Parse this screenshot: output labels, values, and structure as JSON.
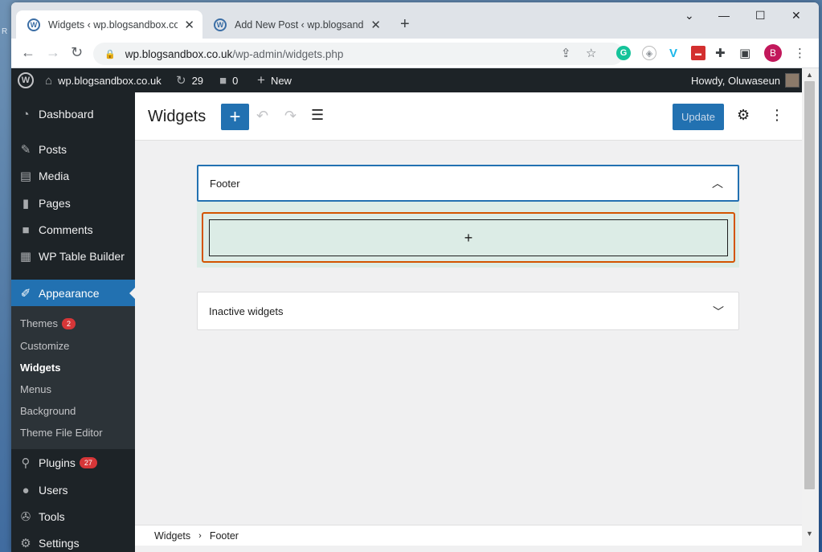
{
  "desktop": {
    "edge_text": "R"
  },
  "browser": {
    "tabs": [
      {
        "title": "Widgets ‹ wp.blogsandbox.co.uk",
        "favicon": "wordpress-icon"
      },
      {
        "title": "Add New Post ‹ wp.blogsandbox.co.uk",
        "favicon": "wordpress-icon"
      }
    ],
    "url_host": "wp.blogsandbox.co.uk",
    "url_path": "/wp-admin/widgets.php",
    "profile_initial": "B",
    "window_controls": [
      "minimize",
      "maximize",
      "close"
    ],
    "extensions": [
      "grammarly-icon",
      "shield-icon",
      "vimeo-icon",
      "red-extension-icon",
      "puzzle-icon",
      "sidepanel-icon"
    ]
  },
  "adminbar": {
    "site_name": "wp.blogsandbox.co.uk",
    "updates_count": "29",
    "comments_count": "0",
    "new_label": "New",
    "howdy": "Howdy, Oluwaseun"
  },
  "sidebar": {
    "items": [
      {
        "label": "Dashboard",
        "icon": "dashboard-icon"
      },
      {
        "label": "Posts",
        "icon": "pin-icon"
      },
      {
        "label": "Media",
        "icon": "media-icon"
      },
      {
        "label": "Pages",
        "icon": "pages-icon"
      },
      {
        "label": "Comments",
        "icon": "comments-icon"
      },
      {
        "label": "WP Table Builder",
        "icon": "table-icon"
      },
      {
        "label": "Appearance",
        "icon": "brush-icon"
      },
      {
        "label": "Plugins",
        "icon": "plugin-icon",
        "badge": "27"
      },
      {
        "label": "Users",
        "icon": "users-icon"
      },
      {
        "label": "Tools",
        "icon": "tools-icon"
      },
      {
        "label": "Settings",
        "icon": "settings-icon"
      }
    ],
    "submenu": [
      {
        "label": "Themes",
        "badge": "2"
      },
      {
        "label": "Customize"
      },
      {
        "label": "Widgets"
      },
      {
        "label": "Menus"
      },
      {
        "label": "Background"
      },
      {
        "label": "Theme File Editor"
      }
    ]
  },
  "editor": {
    "title": "Widgets",
    "update_label": "Update",
    "inserter_symbol": "+",
    "areas": [
      {
        "title": "Footer",
        "state": "expanded"
      },
      {
        "title": "Inactive widgets",
        "state": "collapsed"
      }
    ],
    "appender_symbol": "+",
    "breadcrumb": [
      "Widgets",
      "Footer"
    ]
  },
  "colors": {
    "wp_blue": "#2271b1",
    "admin_dark": "#1d2327",
    "highlight_orange": "#d35400",
    "widget_area_bg": "#dcece6"
  }
}
